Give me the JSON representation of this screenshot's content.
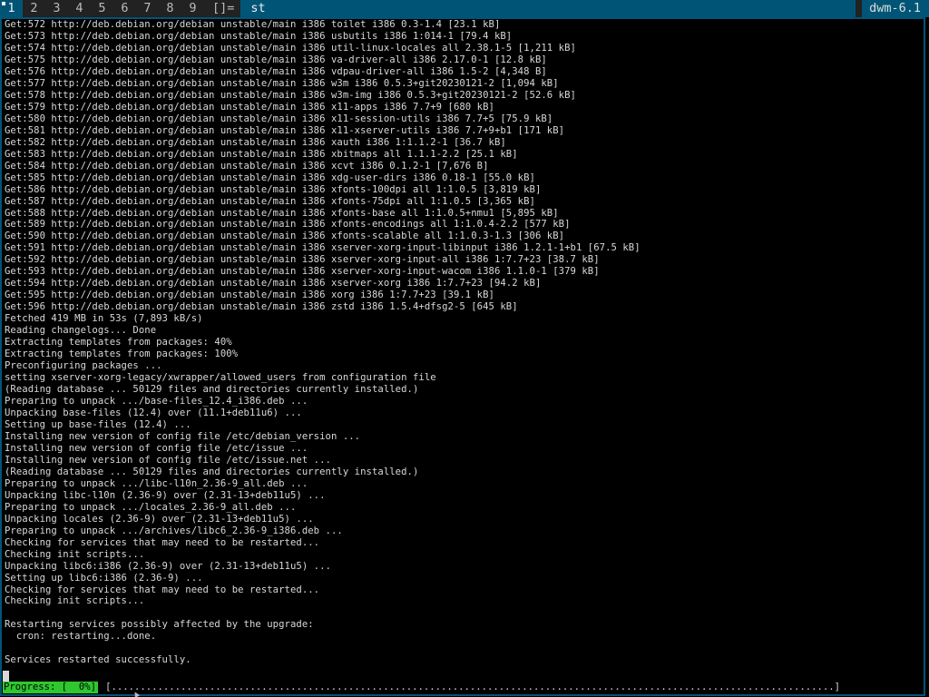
{
  "bar": {
    "tags": [
      "1",
      "2",
      "3",
      "4",
      "5",
      "6",
      "7",
      "8",
      "9"
    ],
    "selected_tag": "1",
    "layout_symbol": "[]=",
    "window_title": "st",
    "status": "dwm-6.1"
  },
  "colors": {
    "bar_bg": "#222222",
    "accent": "#005577",
    "terminal_bg": "#000000",
    "terminal_fg": "#d8d8d8",
    "progress_green": "#2ec82e"
  },
  "terminal": {
    "lines": [
      "Get:572 http://deb.debian.org/debian unstable/main i386 toilet i386 0.3-1.4 [23.1 kB]",
      "Get:573 http://deb.debian.org/debian unstable/main i386 usbutils i386 1:014-1 [79.4 kB]",
      "Get:574 http://deb.debian.org/debian unstable/main i386 util-linux-locales all 2.38.1-5 [1,211 kB]",
      "Get:575 http://deb.debian.org/debian unstable/main i386 va-driver-all i386 2.17.0-1 [12.8 kB]",
      "Get:576 http://deb.debian.org/debian unstable/main i386 vdpau-driver-all i386 1.5-2 [4,348 B]",
      "Get:577 http://deb.debian.org/debian unstable/main i386 w3m i386 0.5.3+git20230121-2 [1,094 kB]",
      "Get:578 http://deb.debian.org/debian unstable/main i386 w3m-img i386 0.5.3+git20230121-2 [52.6 kB]",
      "Get:579 http://deb.debian.org/debian unstable/main i386 x11-apps i386 7.7+9 [680 kB]",
      "Get:580 http://deb.debian.org/debian unstable/main i386 x11-session-utils i386 7.7+5 [75.9 kB]",
      "Get:581 http://deb.debian.org/debian unstable/main i386 x11-xserver-utils i386 7.7+9+b1 [171 kB]",
      "Get:582 http://deb.debian.org/debian unstable/main i386 xauth i386 1:1.1.2-1 [36.7 kB]",
      "Get:583 http://deb.debian.org/debian unstable/main i386 xbitmaps all 1.1.1-2.2 [25.1 kB]",
      "Get:584 http://deb.debian.org/debian unstable/main i386 xcvt i386 0.1.2-1 [7,676 B]",
      "Get:585 http://deb.debian.org/debian unstable/main i386 xdg-user-dirs i386 0.18-1 [55.0 kB]",
      "Get:586 http://deb.debian.org/debian unstable/main i386 xfonts-100dpi all 1:1.0.5 [3,819 kB]",
      "Get:587 http://deb.debian.org/debian unstable/main i386 xfonts-75dpi all 1:1.0.5 [3,365 kB]",
      "Get:588 http://deb.debian.org/debian unstable/main i386 xfonts-base all 1:1.0.5+nmu1 [5,895 kB]",
      "Get:589 http://deb.debian.org/debian unstable/main i386 xfonts-encodings all 1:1.0.4-2.2 [577 kB]",
      "Get:590 http://deb.debian.org/debian unstable/main i386 xfonts-scalable all 1:1.0.3-1.3 [306 kB]",
      "Get:591 http://deb.debian.org/debian unstable/main i386 xserver-xorg-input-libinput i386 1.2.1-1+b1 [67.5 kB]",
      "Get:592 http://deb.debian.org/debian unstable/main i386 xserver-xorg-input-all i386 1:7.7+23 [38.7 kB]",
      "Get:593 http://deb.debian.org/debian unstable/main i386 xserver-xorg-input-wacom i386 1.1.0-1 [379 kB]",
      "Get:594 http://deb.debian.org/debian unstable/main i386 xserver-xorg i386 1:7.7+23 [94.2 kB]",
      "Get:595 http://deb.debian.org/debian unstable/main i386 xorg i386 1:7.7+23 [39.1 kB]",
      "Get:596 http://deb.debian.org/debian unstable/main i386 zstd i386 1.5.4+dfsg2-5 [645 kB]",
      "Fetched 419 MB in 53s (7,893 kB/s)",
      "Reading changelogs... Done",
      "Extracting templates from packages: 40%",
      "Extracting templates from packages: 100%",
      "Preconfiguring packages ...",
      "setting xserver-xorg-legacy/xwrapper/allowed_users from configuration file",
      "(Reading database ... 50129 files and directories currently installed.)",
      "Preparing to unpack .../base-files_12.4_i386.deb ...",
      "Unpacking base-files (12.4) over (11.1+deb11u6) ...",
      "Setting up base-files (12.4) ...",
      "Installing new version of config file /etc/debian_version ...",
      "Installing new version of config file /etc/issue ...",
      "Installing new version of config file /etc/issue.net ...",
      "(Reading database ... 50129 files and directories currently installed.)",
      "Preparing to unpack .../libc-l10n_2.36-9_all.deb ...",
      "Unpacking libc-l10n (2.36-9) over (2.31-13+deb11u5) ...",
      "Preparing to unpack .../locales_2.36-9_all.deb ...",
      "Unpacking locales (2.36-9) over (2.31-13+deb11u5) ...",
      "Preparing to unpack .../archives/libc6_2.36-9_i386.deb ...",
      "Checking for services that may need to be restarted...",
      "Checking init scripts...",
      "Unpacking libc6:i386 (2.36-9) over (2.31-13+deb11u5) ...",
      "Setting up libc6:i386 (2.36-9) ...",
      "Checking for services that may need to be restarted...",
      "Checking init scripts...",
      "",
      "Restarting services possibly affected by the upgrade:",
      "  cron: restarting...done.",
      "",
      "Services restarted successfully."
    ],
    "progress_label": "Progress: [  0%]",
    "progress_percent": 0,
    "progress_track": "[.............................................................................................................................]"
  }
}
